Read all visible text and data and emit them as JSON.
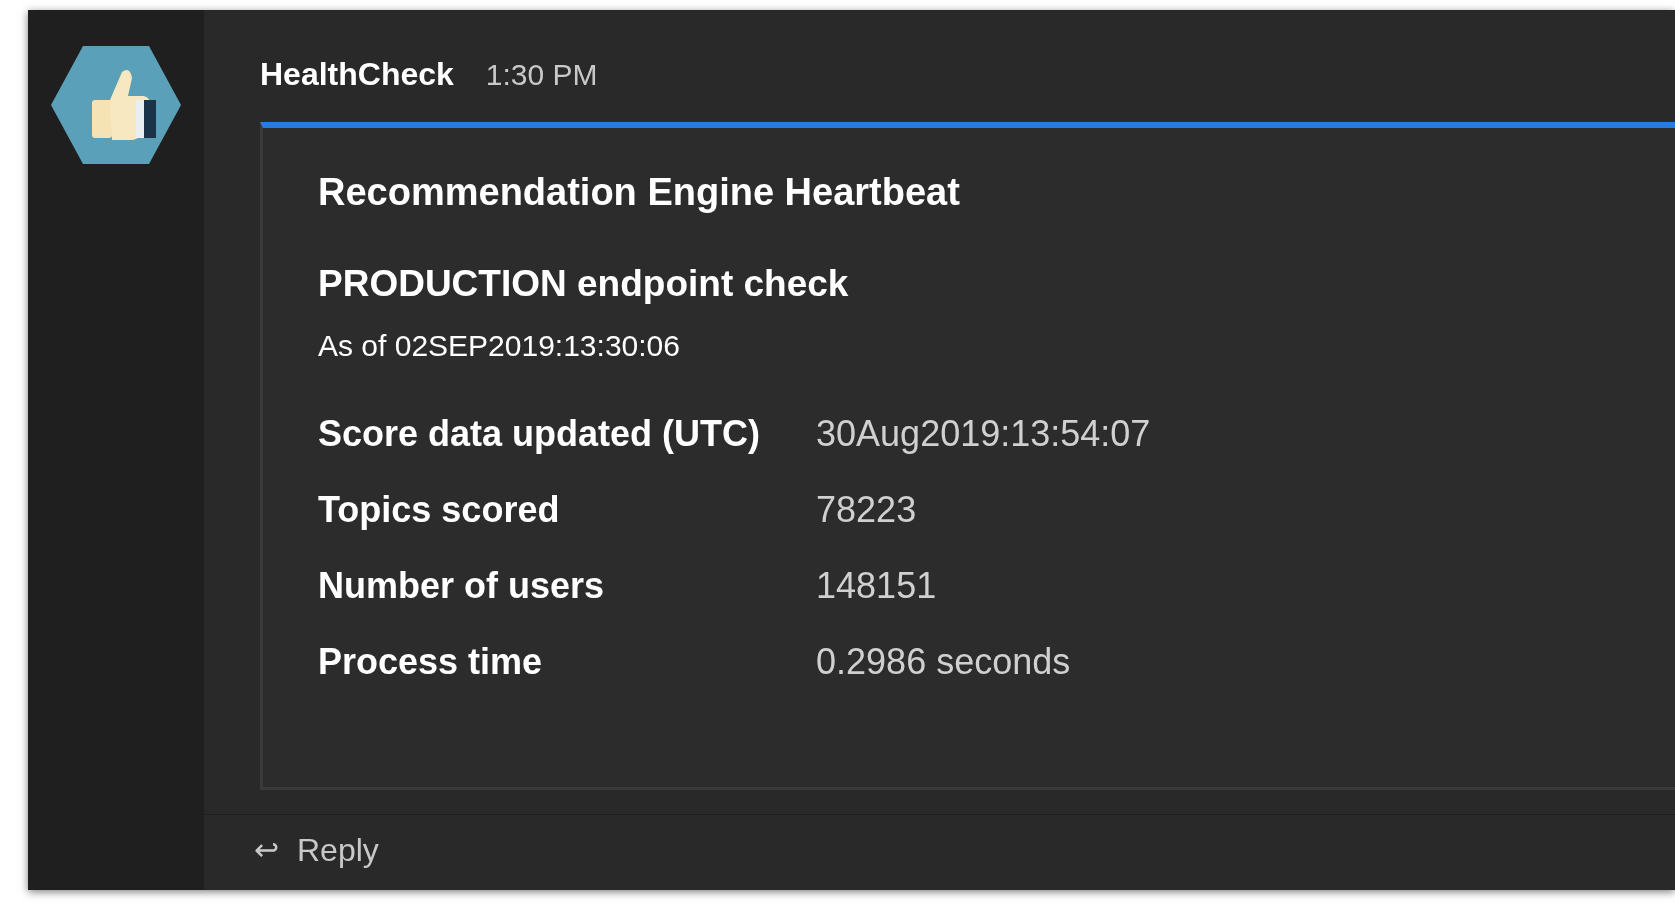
{
  "message": {
    "sender": "HealthCheck",
    "time": "1:30 PM"
  },
  "card": {
    "title": "Recommendation Engine Heartbeat",
    "subtitle": "**PRODUCTION** endpoint check",
    "as_of": "As of 02SEP2019:13:30:06",
    "facts": [
      {
        "label": "Score data updated (UTC)",
        "value": "30Aug2019:13:54:07"
      },
      {
        "label": "Topics scored",
        "value": "78223"
      },
      {
        "label": "Number of users",
        "value": "148151"
      },
      {
        "label": "Process time",
        "value": "0.2986 seconds"
      }
    ]
  },
  "reply": {
    "icon": "↩",
    "label": "Reply"
  }
}
